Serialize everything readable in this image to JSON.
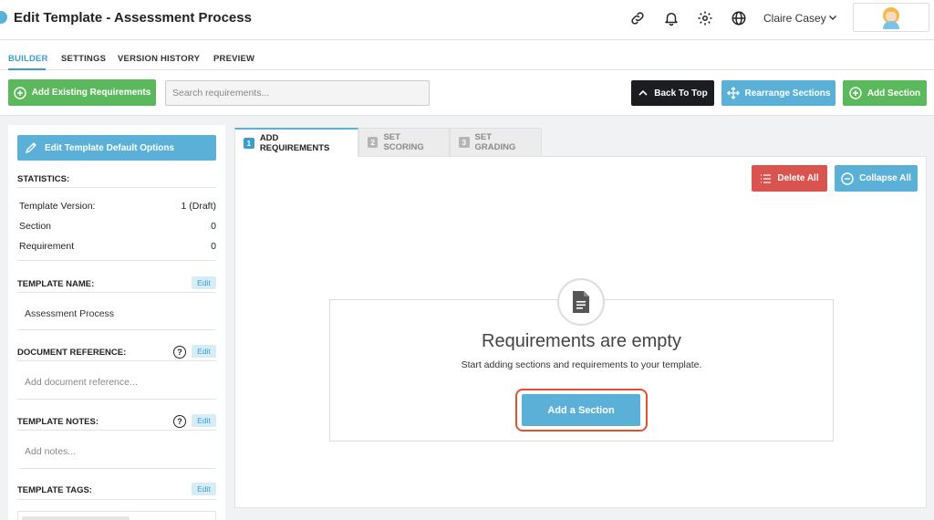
{
  "header": {
    "title": "Edit Template - Assessment Process",
    "user_name": "Claire Casey",
    "icons": [
      "link-icon",
      "bell-icon",
      "gear-icon",
      "globe-icon"
    ]
  },
  "nav": {
    "tabs": [
      {
        "label": "BUILDER",
        "active": true
      },
      {
        "label": "SETTINGS",
        "active": false
      },
      {
        "label": "VERSION HISTORY",
        "active": false
      },
      {
        "label": "PREVIEW",
        "active": false
      }
    ]
  },
  "toolbar": {
    "add_existing_label": "Add Existing Requirements",
    "search_placeholder": "Search requirements...",
    "back_to_top_label": "Back To Top",
    "rearrange_label": "Rearrange Sections",
    "add_section_label": "Add Section"
  },
  "sidebar": {
    "edit_defaults_label": "Edit Template Default Options",
    "statistics_heading": "STATISTICS:",
    "stats": [
      {
        "label": "Template Version:",
        "value": "1 (Draft)"
      },
      {
        "label": "Section",
        "value": "0"
      },
      {
        "label": "Requirement",
        "value": "0"
      }
    ],
    "template_name_heading": "TEMPLATE NAME:",
    "template_name_value": "Assessment Process",
    "document_reference_heading": "DOCUMENT REFERENCE:",
    "document_reference_placeholder": "Add document reference...",
    "template_notes_heading": "TEMPLATE NOTES:",
    "template_notes_placeholder": "Add notes...",
    "template_tags_heading": "TEMPLATE TAGS:",
    "edit_label": "Edit",
    "help_glyph": "?"
  },
  "main": {
    "tabs": [
      {
        "number": "1",
        "label": "ADD REQUIREMENTS",
        "active": true
      },
      {
        "number": "2",
        "label": "SET SCORING",
        "active": false
      },
      {
        "number": "3",
        "label": "SET GRADING",
        "active": false
      }
    ],
    "delete_all_label": "Delete All",
    "collapse_all_label": "Collapse All",
    "empty_state": {
      "title": "Requirements are empty",
      "subtitle": "Start adding sections and requirements to your template.",
      "button_label": "Add a Section"
    }
  },
  "colors": {
    "accent_blue": "#5bb0d8",
    "green": "#5cb85c",
    "red": "#d9534f",
    "dark": "#1c1d21",
    "highlight": "#e0522e"
  }
}
